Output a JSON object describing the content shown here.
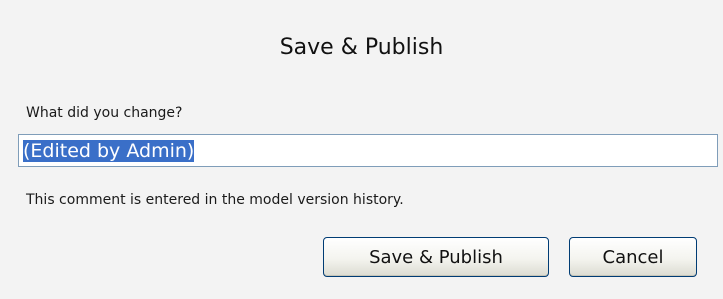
{
  "dialog": {
    "title": "Save & Publish",
    "prompt_label": "What did you change?",
    "comment_value": "(Edited by Admin)",
    "hint": "This comment is entered in the model version history.",
    "save_label": "Save & Publish",
    "cancel_label": "Cancel"
  },
  "colors": {
    "background": "#f3f3f3",
    "selection": "#3a6fc8",
    "input_border": "#7f9db9",
    "button_border": "#003c74"
  }
}
